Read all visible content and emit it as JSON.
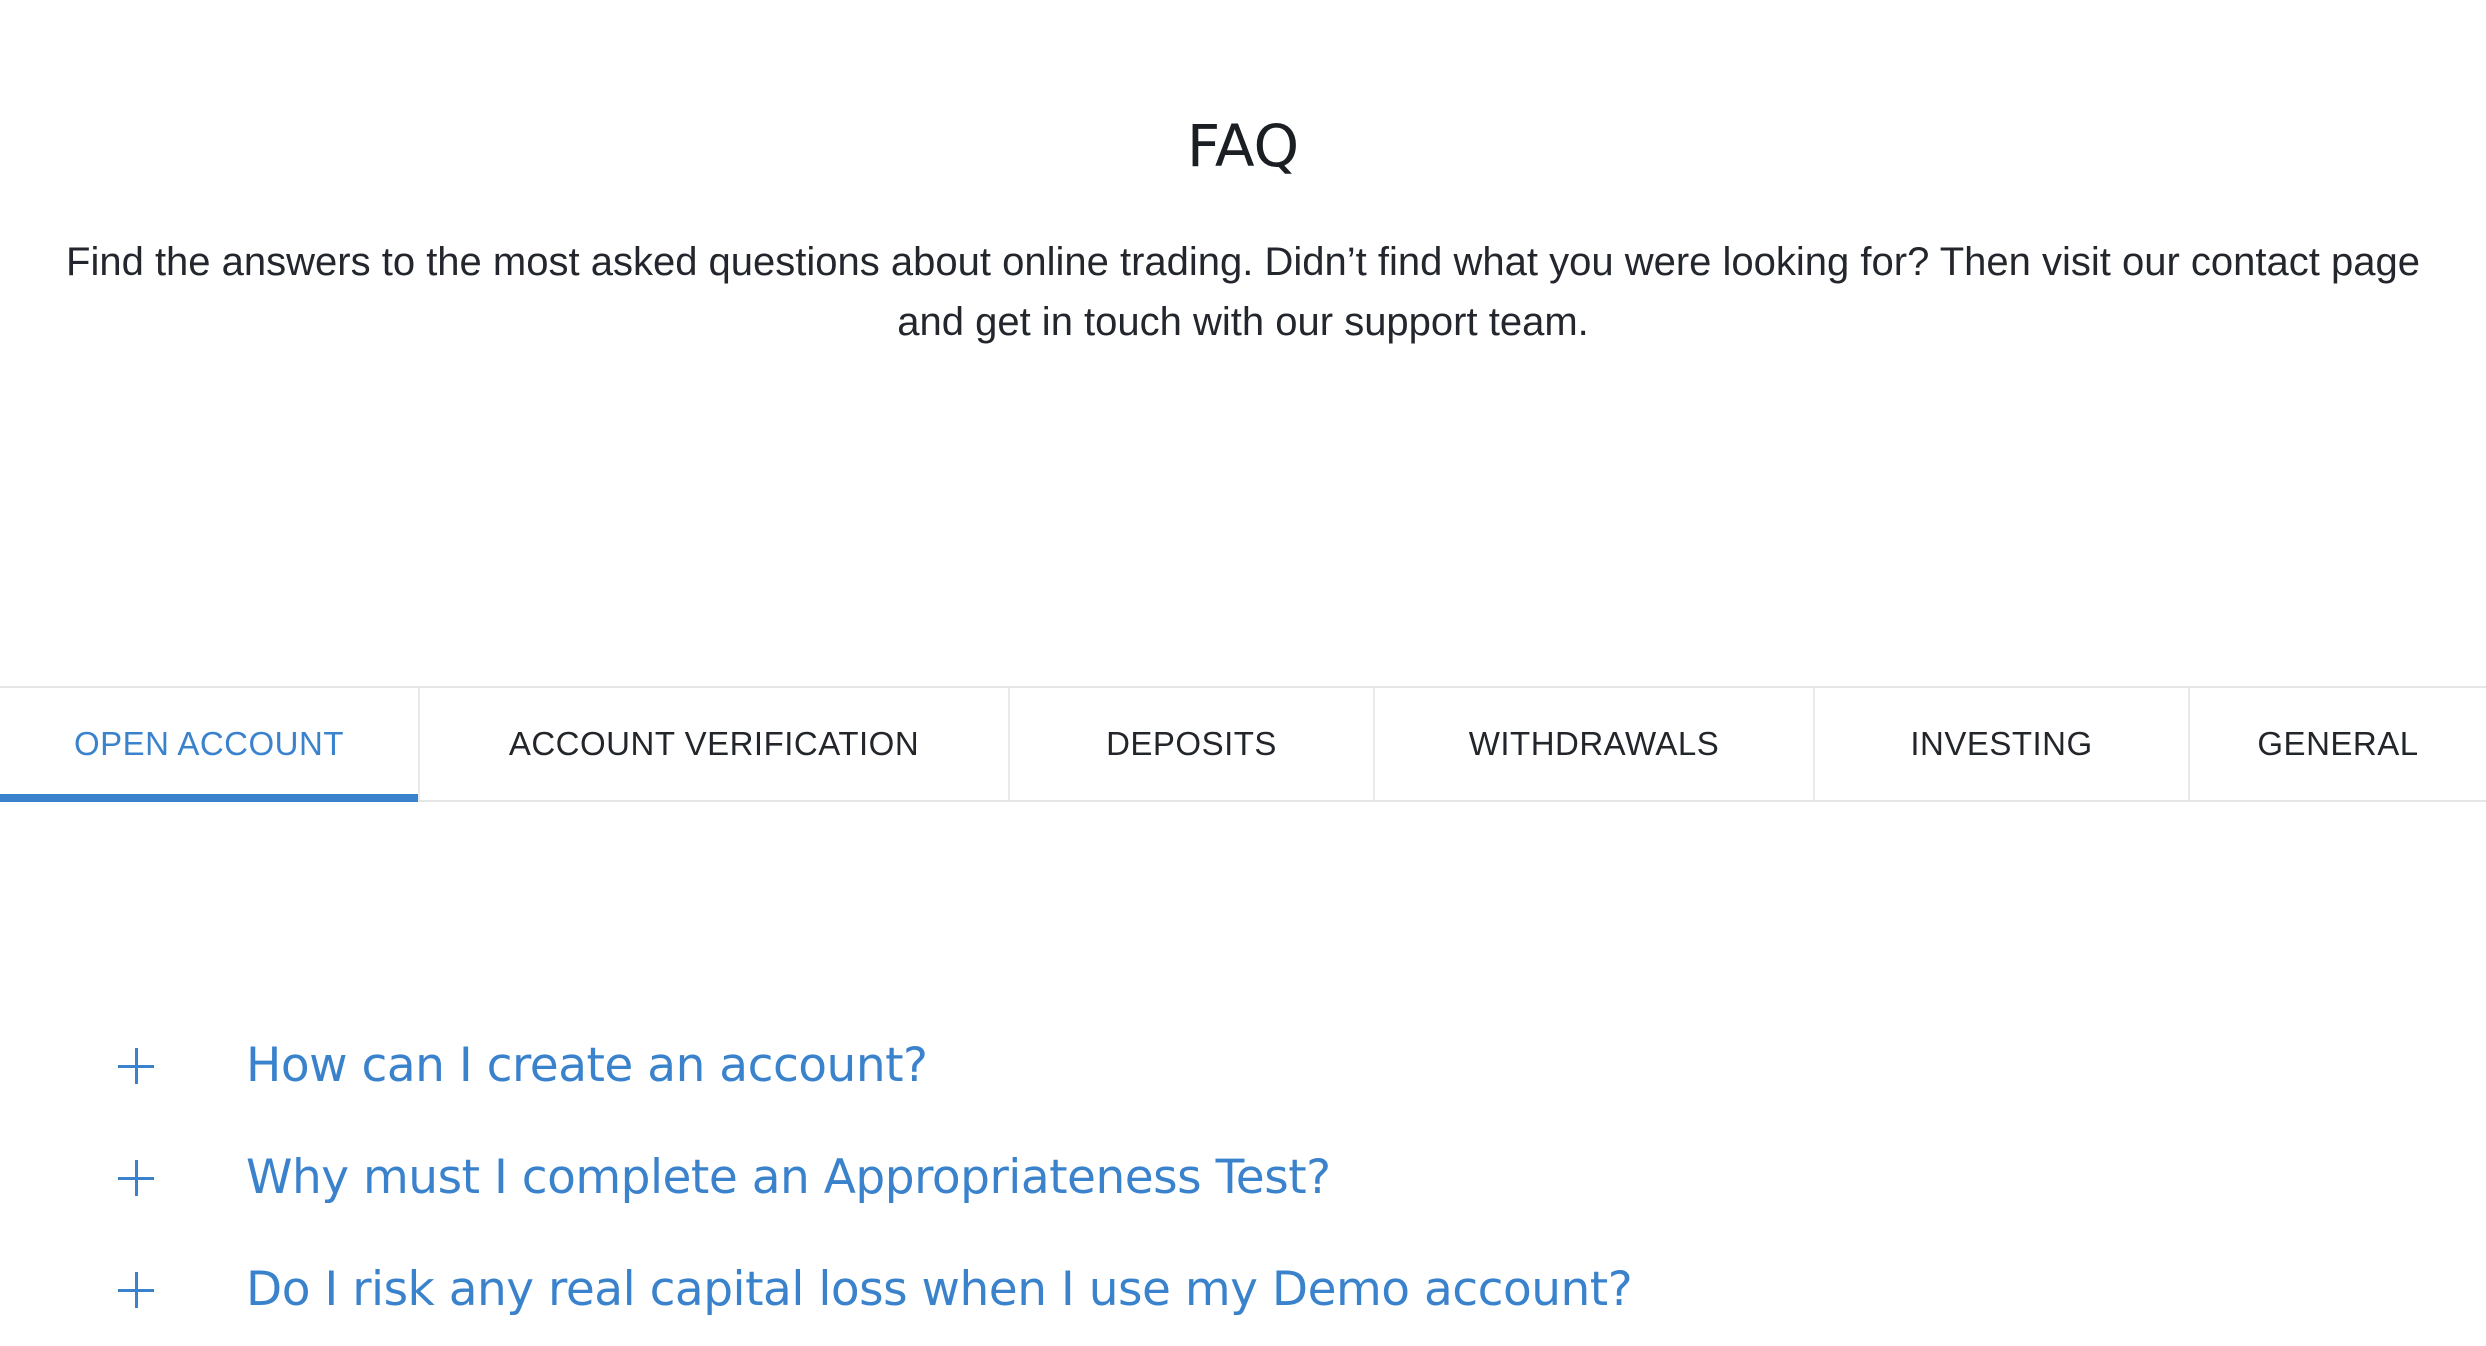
{
  "header": {
    "title": "FAQ",
    "intro": "Find the answers to the most asked questions about online trading. Didn’t find what you were looking for? Then visit our contact page and get in touch with our support team."
  },
  "tabs": [
    {
      "label": "OPEN ACCOUNT",
      "active": true
    },
    {
      "label": "ACCOUNT VERIFICATION",
      "active": false
    },
    {
      "label": "DEPOSITS",
      "active": false
    },
    {
      "label": "WITHDRAWALS",
      "active": false
    },
    {
      "label": "INVESTING",
      "active": false
    },
    {
      "label": "GENERAL",
      "active": false
    }
  ],
  "faq": {
    "items": [
      {
        "question": "How can I create an account?",
        "icon": "plus-icon"
      },
      {
        "question": "Why must I complete an Appropriateness Test?",
        "icon": "plus-icon"
      },
      {
        "question": "Do I risk any real capital loss when I use my Demo account?",
        "icon": "plus-icon"
      }
    ]
  },
  "colors": {
    "accent": "#3a83cc",
    "text": "#23272d",
    "divider": "#e4e6e8"
  }
}
